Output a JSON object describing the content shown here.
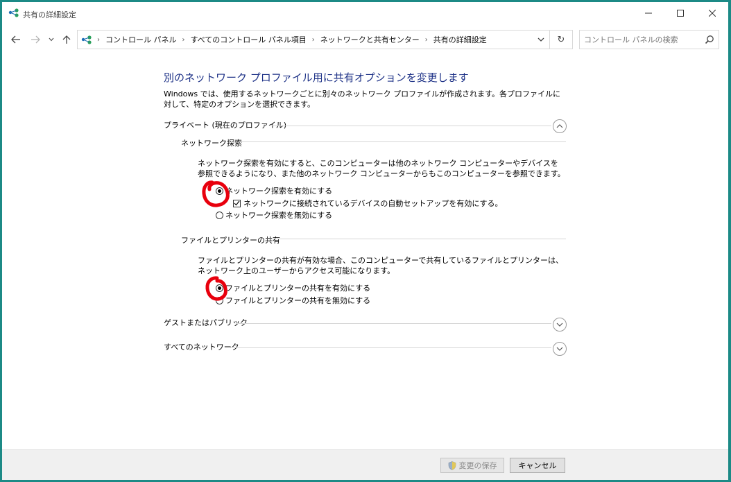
{
  "window": {
    "title": "共有の詳細設定"
  },
  "address": {
    "breadcrumbs": [
      "コントロール パネル",
      "すべてのコントロール パネル項目",
      "ネットワークと共有センター",
      "共有の詳細設定"
    ]
  },
  "search": {
    "placeholder": "コントロール パネルの検索"
  },
  "content": {
    "heading": "別のネットワーク プロファイル用に共有オプションを変更します",
    "description": "Windows では、使用するネットワークごとに別々のネットワーク プロファイルが作成されます。各プロファイルに対して、特定のオプションを選択できます。",
    "private_profile": {
      "label": "プライベート (現在のプロファイル)",
      "expanded": true,
      "network_discovery": {
        "label": "ネットワーク探索",
        "description": "ネットワーク探索を有効にすると、このコンピューターは他のネットワーク コンピューターやデバイスを参照できるようになり、また他のネットワーク コンピューターからもこのコンピューターを参照できます。",
        "enable_label": "ネットワーク探索を有効にする",
        "enable_selected": true,
        "auto_setup_label": "ネットワークに接続されているデバイスの自動セットアップを有効にする。",
        "auto_setup_checked": true,
        "disable_label": "ネットワーク探索を無効にする"
      },
      "file_printer_sharing": {
        "label": "ファイルとプリンターの共有",
        "description": "ファイルとプリンターの共有が有効な場合、このコンピューターで共有しているファイルとプリンターは、ネットワーク上のユーザーからアクセス可能になります。",
        "enable_label": "ファイルとプリンターの共有を有効にする",
        "enable_selected": true,
        "disable_label": "ファイルとプリンターの共有を無効にする"
      }
    },
    "guest_profile": {
      "label": "ゲストまたはパブリック",
      "expanded": false
    },
    "all_networks": {
      "label": "すべてのネットワーク",
      "expanded": false
    }
  },
  "footer": {
    "save_label": "変更の保存",
    "cancel_label": "キャンセル"
  },
  "colors": {
    "heading": "#1e3287",
    "annotation": "#e8000d",
    "desktop": "#1c8a86"
  }
}
